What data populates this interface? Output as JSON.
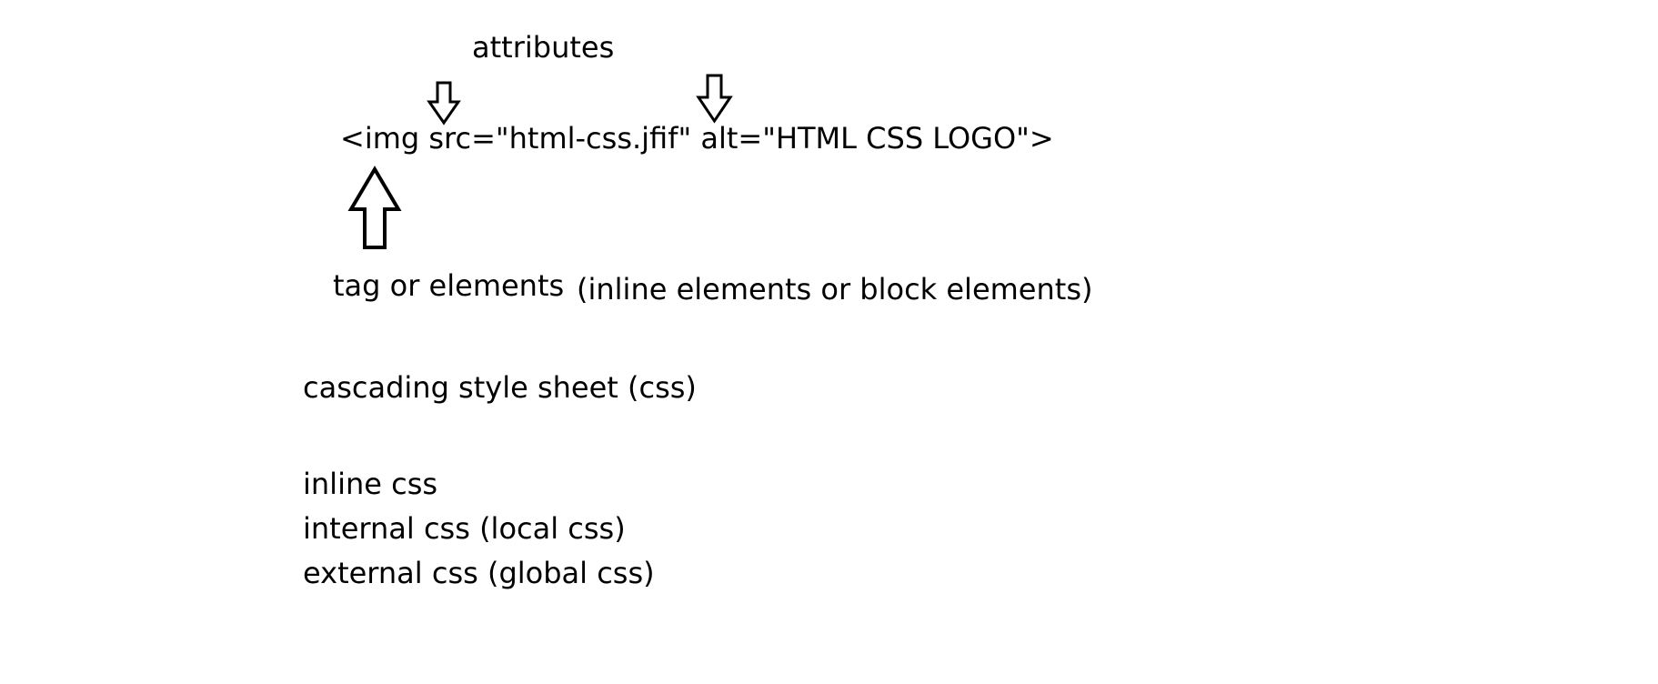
{
  "labels": {
    "attributes": "attributes",
    "code_line": "<img src=\"html-css.jfif\" alt=\"HTML CSS LOGO\">",
    "tag_or_elements": "tag or elements",
    "inline_or_block": "(inline elements or block elements)",
    "css_title": "cascading style sheet (css)"
  },
  "css_types": [
    "inline css",
    "internal css (local css)",
    "external css (global css)"
  ],
  "colors": {
    "text": "#000000",
    "arrow_stroke": "#000000",
    "background": "#ffffff"
  }
}
